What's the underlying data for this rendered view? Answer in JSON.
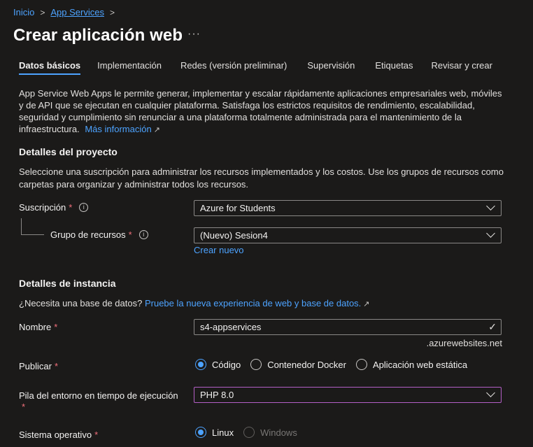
{
  "breadcrumb": {
    "home": "Inicio",
    "current": "App Services"
  },
  "page": {
    "title": "Crear aplicación web",
    "more": "···"
  },
  "tabs": [
    {
      "label": "Datos básicos"
    },
    {
      "label": "Implementación"
    },
    {
      "label": "Redes (versión preliminar)"
    },
    {
      "label": "Supervisión"
    },
    {
      "label": "Etiquetas"
    },
    {
      "label": "Revisar y crear"
    }
  ],
  "intro": {
    "text": "App Service Web Apps le permite generar, implementar y escalar rápidamente aplicaciones empresariales web, móviles y de API que se ejecutan en cualquier plataforma. Satisfaga los estrictos requisitos de rendimiento, escalabilidad, seguridad y cumplimiento sin renunciar a una plataforma totalmente administrada para el mantenimiento de la infraestructura.",
    "link": "Más información"
  },
  "project": {
    "title": "Detalles del proyecto",
    "text": "Seleccione una suscripción para administrar los recursos implementados y los costos. Use los grupos de recursos como carpetas para organizar y administrar todos los recursos.",
    "subscription_label": "Suscripción",
    "subscription_value": "Azure for Students",
    "rg_label": "Grupo de recursos",
    "rg_value": "(Nuevo) Sesion4",
    "create_new": "Crear nuevo"
  },
  "instance": {
    "title": "Detalles de instancia",
    "db_question": "¿Necesita una base de datos?",
    "db_link": "Pruebe la nueva experiencia de web y base de datos.",
    "name_label": "Nombre",
    "name_value": "s4-appservices",
    "name_suffix": ".azurewebsites.net",
    "publish_label": "Publicar",
    "publish_options": [
      "Código",
      "Contenedor Docker",
      "Aplicación web estática"
    ],
    "runtime_label": "Pila del entorno en tiempo de ejecución",
    "runtime_value": "PHP 8.0",
    "os_label": "Sistema operativo",
    "os_options": [
      "Linux",
      "Windows"
    ]
  },
  "required_mark": "*",
  "info_mark": "i",
  "colors": {
    "accent": "#4da3ff",
    "background": "#1b1a19",
    "required": "#f1707b",
    "focus_border": "#b45fc6"
  }
}
